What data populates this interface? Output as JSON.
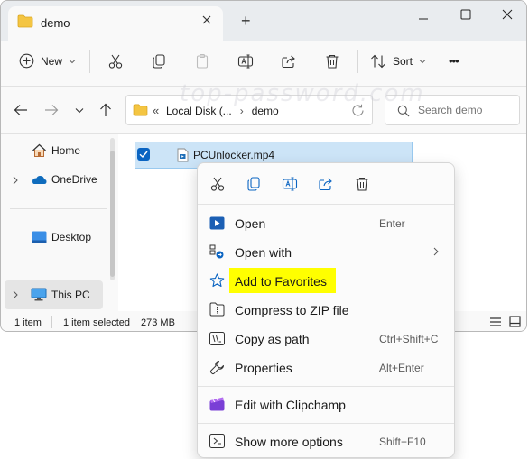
{
  "window": {
    "tab_title": "demo",
    "new_tab_symbol": "+"
  },
  "toolbar": {
    "new_label": "New",
    "sort_label": "Sort",
    "more_symbol": "•••"
  },
  "address": {
    "overflow_symbol": "«",
    "crumbs": [
      "Local Disk (...",
      "demo"
    ],
    "separator": "›"
  },
  "search": {
    "placeholder": "Search demo"
  },
  "watermark": "top-password.com",
  "sidebar": {
    "items": [
      {
        "label": "Home"
      },
      {
        "label": "OneDrive"
      },
      {
        "label": "Desktop"
      },
      {
        "label": "This PC"
      }
    ]
  },
  "files": [
    {
      "name": "PCUnlocker.mp4",
      "selected": true
    }
  ],
  "status": {
    "count": "1 item",
    "selection": "1 item selected",
    "size": "273 MB"
  },
  "context_menu": {
    "quick_actions": [
      "cut-icon",
      "copy-icon",
      "rename-icon",
      "share-icon",
      "delete-icon"
    ],
    "items": [
      {
        "label": "Open",
        "shortcut": "Enter"
      },
      {
        "label": "Open with",
        "shortcut": ""
      },
      {
        "label": "Add to Favorites",
        "shortcut": "",
        "highlight": "#ffff00"
      },
      {
        "label": "Compress to ZIP file",
        "shortcut": ""
      },
      {
        "label": "Copy as path",
        "shortcut": "Ctrl+Shift+C"
      },
      {
        "label": "Properties",
        "shortcut": "Alt+Enter"
      },
      {
        "label": "Edit with Clipchamp",
        "shortcut": ""
      },
      {
        "label": "Show more options",
        "shortcut": "Shift+F10"
      }
    ]
  },
  "colors": {
    "accent": "#0a64c2",
    "selection": "#cce4f7",
    "highlight": "#ffff00",
    "folder": "#f4c542"
  }
}
